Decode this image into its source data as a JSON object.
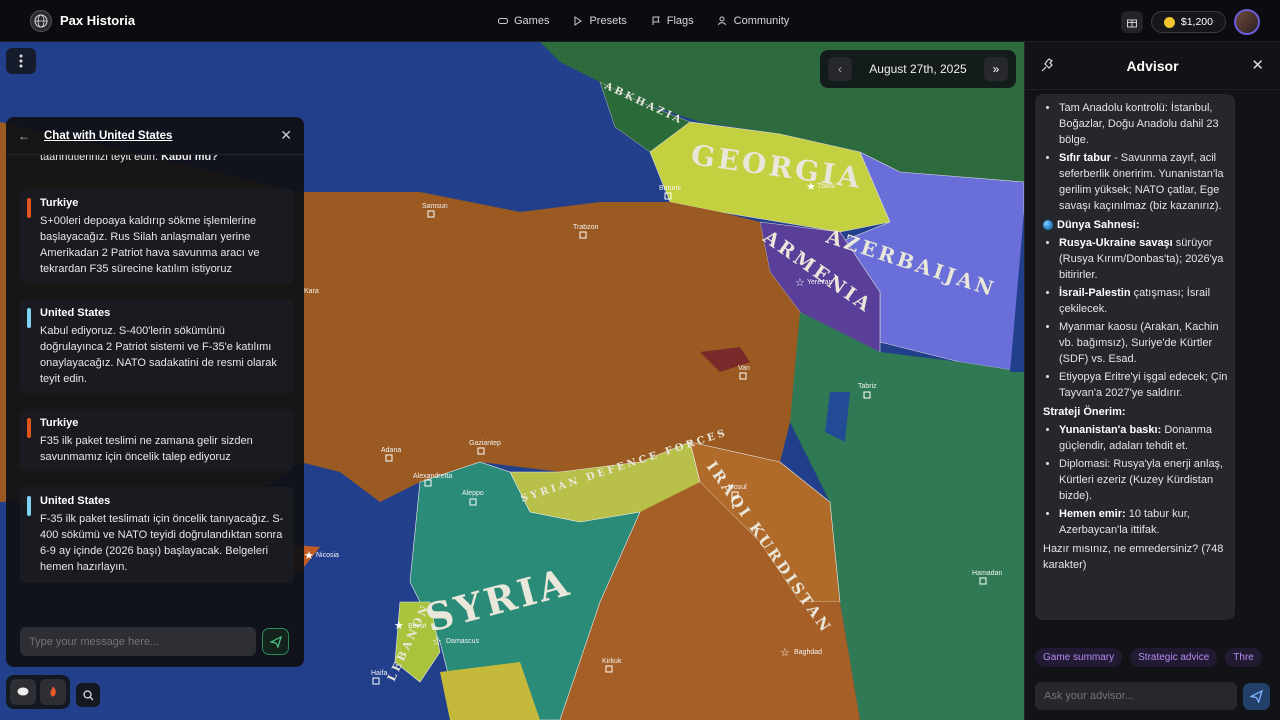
{
  "app": {
    "name": "Pax Historia"
  },
  "nav": [
    {
      "label": "Games",
      "icon": "gamepad-icon"
    },
    {
      "label": "Presets",
      "icon": "play-icon"
    },
    {
      "label": "Flags",
      "icon": "flag-icon"
    },
    {
      "label": "Community",
      "icon": "users-icon"
    }
  ],
  "user": {
    "balance": "$1,200"
  },
  "date": {
    "label": "August 27th, 2025"
  },
  "map": {
    "countries": [
      "GEORGIA",
      "ARMENIA",
      "AZERBAIJAN",
      "SYRIA",
      "IRAQI KURDISTAN",
      "SYRIAN DEFENCE FORCES",
      "LEBANON",
      "ABKHAZIA"
    ],
    "cities": [
      "Tbilisi",
      "Yerevan",
      "Tabriz",
      "Baghdad",
      "Damascus",
      "Nicosia",
      "Aleppo",
      "Batumi",
      "Samsun",
      "Trabzon",
      "Adana",
      "Gaziantep",
      "Alexandretta",
      "Mosul",
      "Van",
      "Kirkuk",
      "Hamadan",
      "Beirut",
      "Haifa",
      "Kara"
    ]
  },
  "chat": {
    "title": "Chat with United States",
    "fragment_text": "taahhütlerinizi teyit edin. ",
    "fragment_bold": "Kabul mü?",
    "input_placeholder": "Type your message here...",
    "messages": [
      {
        "from": "Turkiye",
        "color": "#e0531f",
        "text": "S+00leri depoaya kaldırıp sökme işlemlerine başlayacağız. Rus Silah anlaşmaları yerine Amerikadan 2 Patriot hava savunma aracı ve tekrardan F35 sürecine katılım istiyoruz"
      },
      {
        "from": "United States",
        "color": "#7fd3f5",
        "text": "Kabul ediyoruz. S-400'lerin sökümünü doğrulayınca 2 Patriot sistemi ve F-35'e katılımı onaylayacağız. NATO sadakatini de resmi olarak teyit edin."
      },
      {
        "from": "Turkiye",
        "color": "#e0531f",
        "text": "F35 ilk paket teslimi ne zamana gelir sizden savunmamız için öncelik talep ediyoruz"
      },
      {
        "from": "United States",
        "color": "#7fd3f5",
        "text": "F-35 ilk paket teslimatı için öncelik tanıyacağız. S-400 sökümü ve NATO teyidi doğrulandıktan sonra 6-9 ay içinde (2026 başı) başlayacak. Belgeleri hemen hazırlayın."
      }
    ]
  },
  "advisor": {
    "title": "Advisor",
    "list1": [
      {
        "bold": "",
        "text": "Tam Anadolu kontrolü: İstanbul, Boğazlar, Doğu Anadolu dahil 23 bölge."
      },
      {
        "bold": "Sıfır tabur",
        "text": " - Savunma zayıf, acil seferberlik öneririm. Yunanistan'la gerilim yüksek; NATO çatlar, Ege savaşı kaçınılmaz (biz kazanırız)."
      }
    ],
    "heading_world": "Dünya Sahnesi:",
    "list2": [
      {
        "bold": "Rusya-Ukraine savaşı",
        "text": " sürüyor (Rusya Kırım/Donbas'ta); 2026'ya bitirirler."
      },
      {
        "bold": "İsrail-Palestin",
        "text": " çatışması; İsrail çekilecek."
      },
      {
        "bold": "",
        "text": "Myanmar kaosu (Arakan, Kachin vb. bağımsız), Suriye'de Kürtler (SDF) vs. Esad."
      },
      {
        "bold": "",
        "text": "Etiyopya Eritre'yi işgal edecek; Çin Tayvan'a 2027'ye saldırır."
      }
    ],
    "heading_strategy": "Strateji Önerim:",
    "list3": [
      {
        "bold": "Yunanistan'a baskı:",
        "text": " Donanma güçlendir, adaları tehdit et."
      },
      {
        "bold": "",
        "text": "Diplomasi: Rusya'yla enerji anlaş, Kürtleri ezeriz (Kuzey Kürdistan bizde)."
      },
      {
        "bold": "Hemen emir:",
        "text": " 10 tabur kur, Azerbaycan'la ittifak."
      }
    ],
    "closing": "Hazır mısınız, ne emredersiniz? (748 karakter)",
    "chips": [
      "Game summary",
      "Strategic advice",
      "Thre"
    ],
    "input_placeholder": "Ask your advisor..."
  }
}
